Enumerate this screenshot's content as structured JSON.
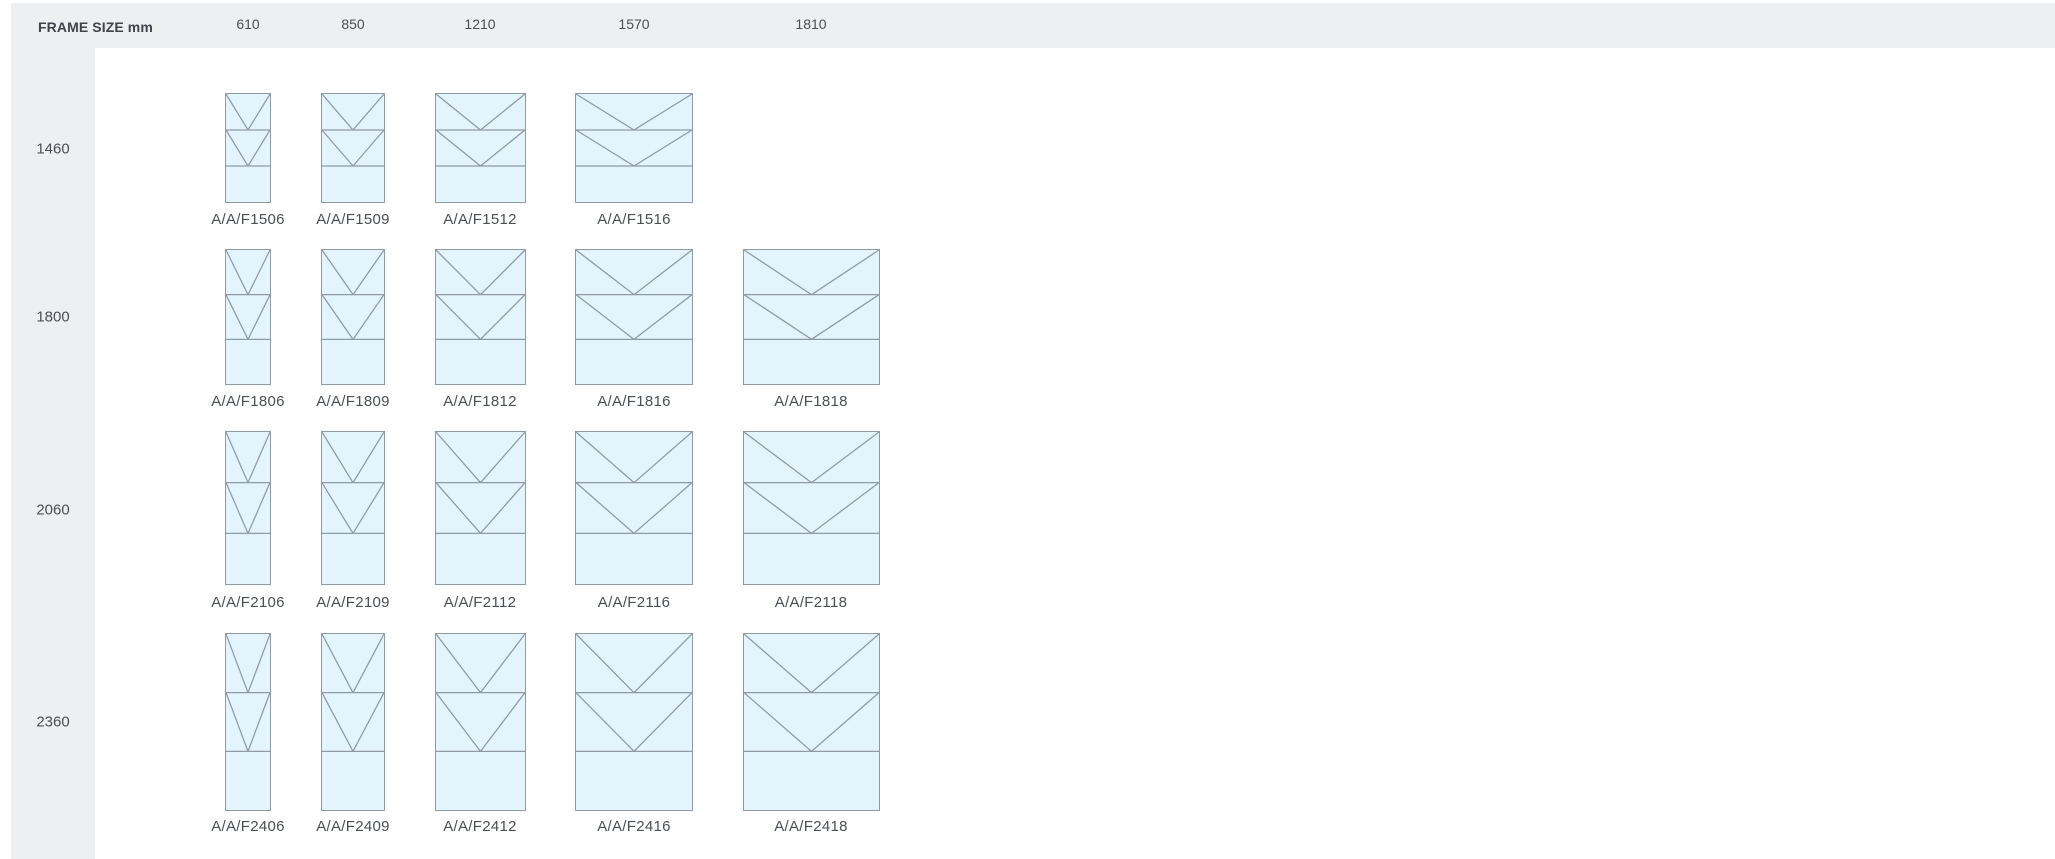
{
  "table": {
    "header_label": "FRAME SIZE mm",
    "widths": [
      "610",
      "850",
      "1210",
      "1570",
      "1810"
    ],
    "rows": [
      {
        "height": "1460",
        "codes": [
          "A/A/F1506",
          "A/A/F1509",
          "A/A/F1512",
          "A/A/F1516",
          null
        ]
      },
      {
        "height": "1800",
        "codes": [
          "A/A/F1806",
          "A/A/F1809",
          "A/A/F1812",
          "A/A/F1816",
          "A/A/F1818"
        ]
      },
      {
        "height": "2060",
        "codes": [
          "A/A/F2106",
          "A/A/F2109",
          "A/A/F2112",
          "A/A/F2116",
          "A/A/F2118"
        ]
      },
      {
        "height": "2360",
        "codes": [
          "A/A/F2406",
          "A/A/F2409",
          "A/A/F2412",
          "A/A/F2416",
          "A/A/F2418"
        ]
      }
    ]
  },
  "colors": {
    "header_background": "#eeeff1",
    "glass_fill": "#e4f4fc",
    "frame_line": "#8f9aa3",
    "text": "#4a4f55"
  }
}
